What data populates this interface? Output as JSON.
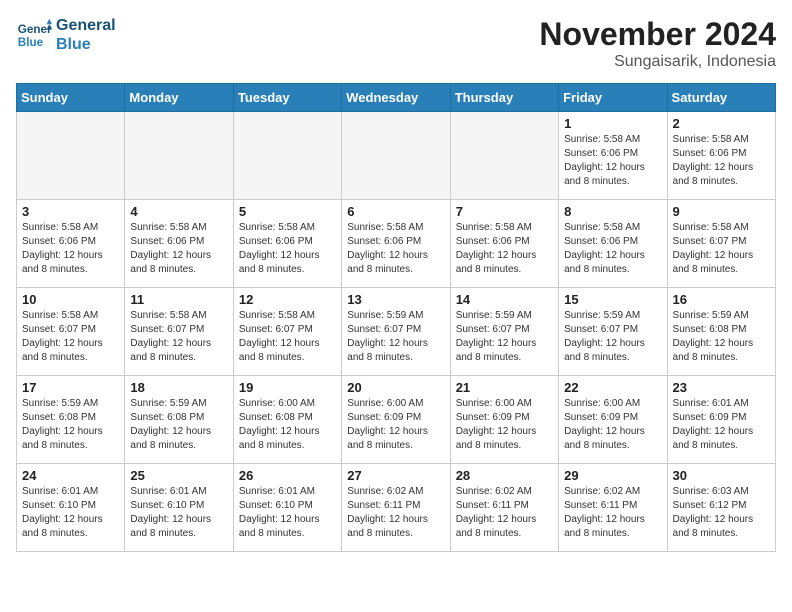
{
  "header": {
    "logo_line1": "General",
    "logo_line2": "Blue",
    "month_title": "November 2024",
    "location": "Sungaisarik, Indonesia"
  },
  "days_of_week": [
    "Sunday",
    "Monday",
    "Tuesday",
    "Wednesday",
    "Thursday",
    "Friday",
    "Saturday"
  ],
  "weeks": [
    [
      {
        "day": "",
        "empty": true
      },
      {
        "day": "",
        "empty": true
      },
      {
        "day": "",
        "empty": true
      },
      {
        "day": "",
        "empty": true
      },
      {
        "day": "",
        "empty": true
      },
      {
        "day": "1",
        "sunrise": "Sunrise: 5:58 AM",
        "sunset": "Sunset: 6:06 PM",
        "daylight": "Daylight: 12 hours and 8 minutes."
      },
      {
        "day": "2",
        "sunrise": "Sunrise: 5:58 AM",
        "sunset": "Sunset: 6:06 PM",
        "daylight": "Daylight: 12 hours and 8 minutes."
      }
    ],
    [
      {
        "day": "3",
        "sunrise": "Sunrise: 5:58 AM",
        "sunset": "Sunset: 6:06 PM",
        "daylight": "Daylight: 12 hours and 8 minutes."
      },
      {
        "day": "4",
        "sunrise": "Sunrise: 5:58 AM",
        "sunset": "Sunset: 6:06 PM",
        "daylight": "Daylight: 12 hours and 8 minutes."
      },
      {
        "day": "5",
        "sunrise": "Sunrise: 5:58 AM",
        "sunset": "Sunset: 6:06 PM",
        "daylight": "Daylight: 12 hours and 8 minutes."
      },
      {
        "day": "6",
        "sunrise": "Sunrise: 5:58 AM",
        "sunset": "Sunset: 6:06 PM",
        "daylight": "Daylight: 12 hours and 8 minutes."
      },
      {
        "day": "7",
        "sunrise": "Sunrise: 5:58 AM",
        "sunset": "Sunset: 6:06 PM",
        "daylight": "Daylight: 12 hours and 8 minutes."
      },
      {
        "day": "8",
        "sunrise": "Sunrise: 5:58 AM",
        "sunset": "Sunset: 6:06 PM",
        "daylight": "Daylight: 12 hours and 8 minutes."
      },
      {
        "day": "9",
        "sunrise": "Sunrise: 5:58 AM",
        "sunset": "Sunset: 6:07 PM",
        "daylight": "Daylight: 12 hours and 8 minutes."
      }
    ],
    [
      {
        "day": "10",
        "sunrise": "Sunrise: 5:58 AM",
        "sunset": "Sunset: 6:07 PM",
        "daylight": "Daylight: 12 hours and 8 minutes."
      },
      {
        "day": "11",
        "sunrise": "Sunrise: 5:58 AM",
        "sunset": "Sunset: 6:07 PM",
        "daylight": "Daylight: 12 hours and 8 minutes."
      },
      {
        "day": "12",
        "sunrise": "Sunrise: 5:58 AM",
        "sunset": "Sunset: 6:07 PM",
        "daylight": "Daylight: 12 hours and 8 minutes."
      },
      {
        "day": "13",
        "sunrise": "Sunrise: 5:59 AM",
        "sunset": "Sunset: 6:07 PM",
        "daylight": "Daylight: 12 hours and 8 minutes."
      },
      {
        "day": "14",
        "sunrise": "Sunrise: 5:59 AM",
        "sunset": "Sunset: 6:07 PM",
        "daylight": "Daylight: 12 hours and 8 minutes."
      },
      {
        "day": "15",
        "sunrise": "Sunrise: 5:59 AM",
        "sunset": "Sunset: 6:07 PM",
        "daylight": "Daylight: 12 hours and 8 minutes."
      },
      {
        "day": "16",
        "sunrise": "Sunrise: 5:59 AM",
        "sunset": "Sunset: 6:08 PM",
        "daylight": "Daylight: 12 hours and 8 minutes."
      }
    ],
    [
      {
        "day": "17",
        "sunrise": "Sunrise: 5:59 AM",
        "sunset": "Sunset: 6:08 PM",
        "daylight": "Daylight: 12 hours and 8 minutes."
      },
      {
        "day": "18",
        "sunrise": "Sunrise: 5:59 AM",
        "sunset": "Sunset: 6:08 PM",
        "daylight": "Daylight: 12 hours and 8 minutes."
      },
      {
        "day": "19",
        "sunrise": "Sunrise: 6:00 AM",
        "sunset": "Sunset: 6:08 PM",
        "daylight": "Daylight: 12 hours and 8 minutes."
      },
      {
        "day": "20",
        "sunrise": "Sunrise: 6:00 AM",
        "sunset": "Sunset: 6:09 PM",
        "daylight": "Daylight: 12 hours and 8 minutes."
      },
      {
        "day": "21",
        "sunrise": "Sunrise: 6:00 AM",
        "sunset": "Sunset: 6:09 PM",
        "daylight": "Daylight: 12 hours and 8 minutes."
      },
      {
        "day": "22",
        "sunrise": "Sunrise: 6:00 AM",
        "sunset": "Sunset: 6:09 PM",
        "daylight": "Daylight: 12 hours and 8 minutes."
      },
      {
        "day": "23",
        "sunrise": "Sunrise: 6:01 AM",
        "sunset": "Sunset: 6:09 PM",
        "daylight": "Daylight: 12 hours and 8 minutes."
      }
    ],
    [
      {
        "day": "24",
        "sunrise": "Sunrise: 6:01 AM",
        "sunset": "Sunset: 6:10 PM",
        "daylight": "Daylight: 12 hours and 8 minutes."
      },
      {
        "day": "25",
        "sunrise": "Sunrise: 6:01 AM",
        "sunset": "Sunset: 6:10 PM",
        "daylight": "Daylight: 12 hours and 8 minutes."
      },
      {
        "day": "26",
        "sunrise": "Sunrise: 6:01 AM",
        "sunset": "Sunset: 6:10 PM",
        "daylight": "Daylight: 12 hours and 8 minutes."
      },
      {
        "day": "27",
        "sunrise": "Sunrise: 6:02 AM",
        "sunset": "Sunset: 6:11 PM",
        "daylight": "Daylight: 12 hours and 8 minutes."
      },
      {
        "day": "28",
        "sunrise": "Sunrise: 6:02 AM",
        "sunset": "Sunset: 6:11 PM",
        "daylight": "Daylight: 12 hours and 8 minutes."
      },
      {
        "day": "29",
        "sunrise": "Sunrise: 6:02 AM",
        "sunset": "Sunset: 6:11 PM",
        "daylight": "Daylight: 12 hours and 8 minutes."
      },
      {
        "day": "30",
        "sunrise": "Sunrise: 6:03 AM",
        "sunset": "Sunset: 6:12 PM",
        "daylight": "Daylight: 12 hours and 8 minutes."
      }
    ]
  ]
}
